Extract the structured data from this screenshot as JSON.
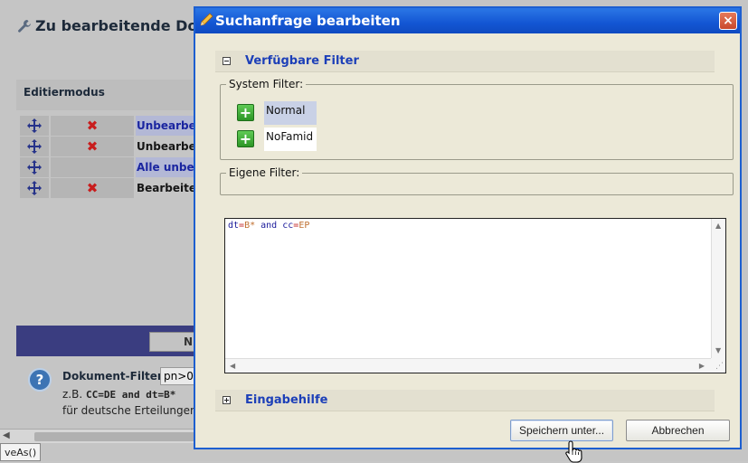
{
  "background": {
    "title": "Zu bearbeitende Doku",
    "edit_mode_header": "Editiermodus",
    "rows": [
      {
        "name": "Unbearbe",
        "highlight": true,
        "deletable": true
      },
      {
        "name": "Unbearbe",
        "highlight": false,
        "deletable": true
      },
      {
        "name": "Alle unbe",
        "highlight": true,
        "deletable": false
      },
      {
        "name": "Bearbeite",
        "highlight": false,
        "deletable": true
      }
    ],
    "nav_button_label": "N",
    "doc_filter_label": "Dokument-Filter:",
    "doc_filter_value": "pn>0",
    "example_prefix": "z.B.",
    "example_code": "CC=DE and dt=B*",
    "example_desc": "für deutsche Erteilungen",
    "status_tooltip": "veAs()"
  },
  "dialog": {
    "title": "Suchanfrage bearbeiten",
    "close_label": "×",
    "available_filters": {
      "title": "Verfügbare Filter",
      "expanded": true,
      "system_filter_label": "System Filter:",
      "system_filters": [
        {
          "name": "Normal",
          "selected": true
        },
        {
          "name": "NoFamid",
          "selected": false
        }
      ],
      "custom_filter_label": "Eigene Filter:"
    },
    "query": {
      "tokens": [
        {
          "text": "dt",
          "kind": "field"
        },
        {
          "text": "=",
          "kind": "op"
        },
        {
          "text": "B*",
          "kind": "val"
        },
        {
          "text": " and ",
          "kind": "kw"
        },
        {
          "text": "cc",
          "kind": "field"
        },
        {
          "text": "=",
          "kind": "op"
        },
        {
          "text": "EP",
          "kind": "val"
        }
      ]
    },
    "input_help": {
      "title": "Eingabehilfe",
      "expanded": false
    },
    "buttons": {
      "save_as": "Speichern unter...",
      "cancel": "Abbrechen"
    }
  },
  "colors": {
    "titlebar": "#1356d3",
    "section_title": "#1c3fb8",
    "dialog_bg": "#ece9d8",
    "plus_green": "#2c9626"
  },
  "icons": {
    "title_icon": "pencil-icon",
    "bg_title_icon": "wrench-icon",
    "move": "move-arrows-icon",
    "delete": "red-x-icon",
    "help": "question-icon",
    "add": "green-plus-icon"
  }
}
